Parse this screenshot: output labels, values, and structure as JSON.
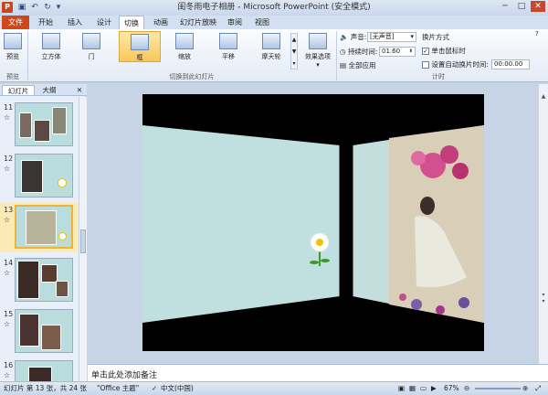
{
  "window": {
    "title": "闺冬雨电子相册 - Microsoft PowerPoint (安全模式)",
    "app_icon": "P",
    "controls": [
      "─",
      "□",
      "✕"
    ]
  },
  "quick_access": [
    "save-icon",
    "undo-icon",
    "redo-icon",
    "customize-icon"
  ],
  "tabs": [
    {
      "label": "文件",
      "active": false
    },
    {
      "label": "开始",
      "active": false
    },
    {
      "label": "插入",
      "active": false
    },
    {
      "label": "设计",
      "active": false
    },
    {
      "label": "切换",
      "active": true
    },
    {
      "label": "动画",
      "active": false
    },
    {
      "label": "幻灯片放映",
      "active": false
    },
    {
      "label": "审阅",
      "active": false
    },
    {
      "label": "视图",
      "active": false
    }
  ],
  "ribbon": {
    "preview": {
      "label": "预览",
      "group": "预览"
    },
    "transitions": [
      {
        "label": "立方体",
        "selected": false
      },
      {
        "label": "门",
        "selected": false
      },
      {
        "label": "框",
        "selected": true
      },
      {
        "label": "缩放",
        "selected": false
      },
      {
        "label": "平移",
        "selected": false
      },
      {
        "label": "摩天轮",
        "selected": false
      }
    ],
    "transitions_group": "切换到此幻灯片",
    "effect_options": "效果选项",
    "timing": {
      "sound_label": "声音:",
      "sound_value": "[无声音]",
      "duration_label": "持续时间:",
      "duration_value": "01.60",
      "apply_all": "全部应用",
      "advance_title": "换片方式",
      "on_click": "单击鼠标时",
      "on_click_checked": true,
      "after_label": "设置自动换片时间:",
      "after_value": "00:00.00",
      "after_checked": false,
      "group": "计时"
    }
  },
  "left_pane": {
    "tabs": [
      "幻灯片",
      "大纲"
    ],
    "close": "✕",
    "slides": [
      {
        "num": "11",
        "mark": "☆"
      },
      {
        "num": "12",
        "mark": "☆"
      },
      {
        "num": "13",
        "mark": "☆",
        "selected": true
      },
      {
        "num": "14",
        "mark": "☆"
      },
      {
        "num": "15",
        "mark": "☆"
      },
      {
        "num": "16",
        "mark": "☆"
      }
    ]
  },
  "notes": {
    "placeholder": "单击此处添加备注"
  },
  "status": {
    "slide_info": "幻灯片 第 13 张，共 24 张",
    "theme": "\"Office 主题\"",
    "language": "中文(中国)",
    "zoom": "67%"
  },
  "colors": {
    "file_tab": "#d0471c",
    "slide_bg": "#000000",
    "wall": "#bfe0df"
  }
}
